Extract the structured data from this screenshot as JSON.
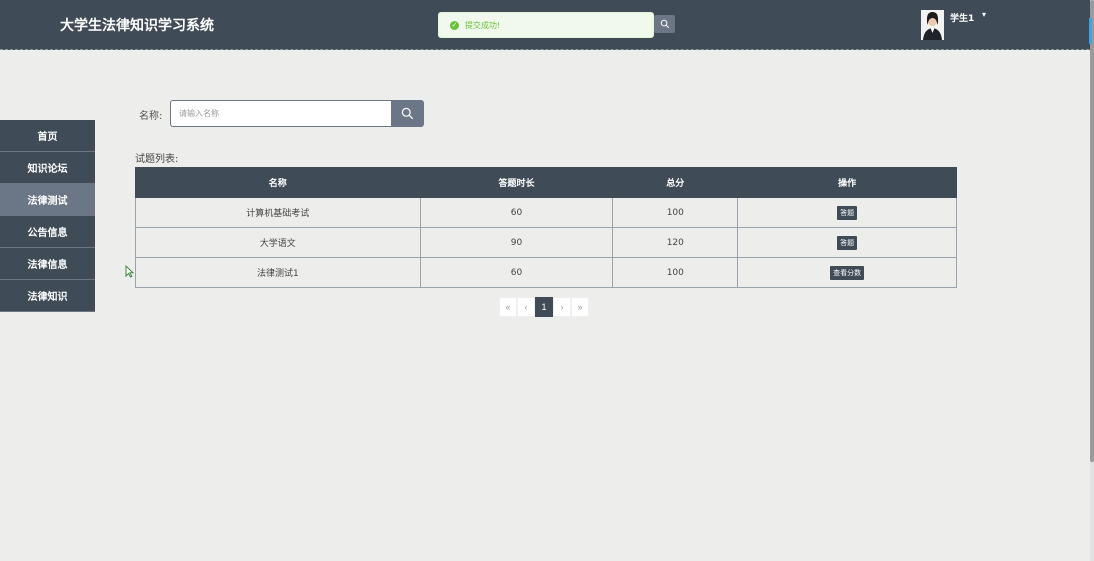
{
  "header": {
    "title": "大学生法律知识学习系统",
    "toast": "提交成功!",
    "user_name": "学生1",
    "user_caret": "▾"
  },
  "sidebar": {
    "items": [
      {
        "label": "首页"
      },
      {
        "label": "知识论坛"
      },
      {
        "label": "法律测试",
        "active": true
      },
      {
        "label": "公告信息"
      },
      {
        "label": "法律信息"
      },
      {
        "label": "法律知识"
      }
    ]
  },
  "search": {
    "label": "名称:",
    "placeholder": "请输入名称",
    "value": ""
  },
  "list": {
    "caption": "试题列表:",
    "columns": [
      "名称",
      "答题时长",
      "总分",
      "操作"
    ],
    "rows": [
      {
        "name": "计算机基础考试",
        "duration": "60",
        "total": "100",
        "action": "答题"
      },
      {
        "name": "大学语文",
        "duration": "90",
        "total": "120",
        "action": "答题"
      },
      {
        "name": "法律测试1",
        "duration": "60",
        "total": "100",
        "action": "查看分数"
      }
    ]
  },
  "pagination": {
    "first": "«",
    "prev": "‹",
    "current": "1",
    "next": "›",
    "last": "»"
  },
  "colors": {
    "header_bg": "#3f4b57",
    "accent": "#6b7686",
    "success": "#67c23a"
  },
  "icons": [
    "search-icon",
    "check-circle-icon",
    "avatar-image",
    "cursor-icon"
  ]
}
